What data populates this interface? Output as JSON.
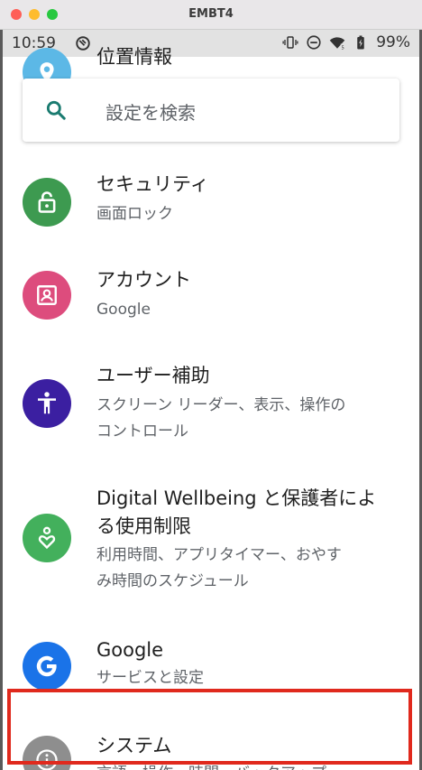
{
  "window": {
    "title": "EMBT4"
  },
  "status_bar": {
    "time": "10:59",
    "battery": "99%"
  },
  "search": {
    "placeholder": "設定を検索"
  },
  "settings": [
    {
      "title": "位置情報",
      "subtitle": "",
      "icon": "location-pin-icon",
      "color": "#5cb8e6"
    },
    {
      "title": "セキュリティ",
      "subtitle": "画面ロック",
      "icon": "unlocked-padlock-icon",
      "color": "#3d9a50"
    },
    {
      "title": "アカウント",
      "subtitle": "Google",
      "icon": "account-box-icon",
      "color": "#dd4c7d"
    },
    {
      "title": "ユーザー補助",
      "subtitle": "スクリーン リーダー、表示、操作の\nコントロール",
      "icon": "accessibility-person-icon",
      "color": "#3b1fa1"
    },
    {
      "title": "Digital Wellbeing と保護者によ\nる使用制限",
      "subtitle": "利用時間、アプリタイマー、おやす\nみ時間のスケジュール",
      "icon": "wellbeing-heart-person-icon",
      "color": "#43b05c"
    },
    {
      "title": "Google",
      "subtitle": "サービスと設定",
      "icon": "google-g-icon",
      "color": "#1a73e8"
    },
    {
      "title": "システム",
      "subtitle": "言語、操作、時間、バックアップ",
      "icon": "info-circle-icon",
      "color": "#8e8e8e"
    }
  ],
  "highlight_color": "#e0291d"
}
